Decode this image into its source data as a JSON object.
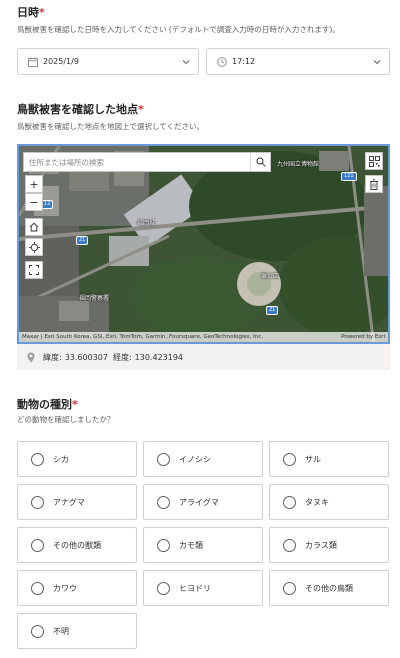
{
  "datetime": {
    "title": "日時",
    "required_mark": "*",
    "description": "鳥獣被害を確認した日時を入力してください (デフォルトで調査入力時の日時が入力されます)。",
    "date_value": "2025/1/9",
    "time_value": "17:12"
  },
  "location": {
    "title": "鳥獣被害を確認した地点",
    "required_mark": "*",
    "description": "鳥獣被害を確認した地点を地図上で選択してください。",
    "search_placeholder": "住所または場所の検索",
    "labels": {
      "building_1": "福岡城",
      "building_2": "九州国立博物館",
      "park": "東公園",
      "station": "福岡警察署"
    },
    "road_numbers": [
      "21",
      "12",
      "121",
      "21"
    ],
    "attribution": "Maxar | Esri South Korea, GSI, Esri, TomTom, Garmin, Foursquare, GeoTechnologies, Inc.",
    "powered_by": "Powered by Esri",
    "latitude_label": "緯度:",
    "latitude": "33.600307",
    "longitude_label": "経度:",
    "longitude": "130.423194"
  },
  "animal": {
    "title": "動物の種別",
    "required_mark": "*",
    "description": "どの動物を確認しましたか？",
    "options": [
      "シカ",
      "イノシシ",
      "サル",
      "アナグマ",
      "アライグマ",
      "タヌキ",
      "その他の獣類",
      "カモ類",
      "カラス類",
      "カワウ",
      "ヒヨドリ",
      "その他の鳥類",
      "不明"
    ]
  },
  "colors": {
    "required": "#d13438",
    "map_border": "#6a98d8",
    "border": "#d2d0ce"
  }
}
